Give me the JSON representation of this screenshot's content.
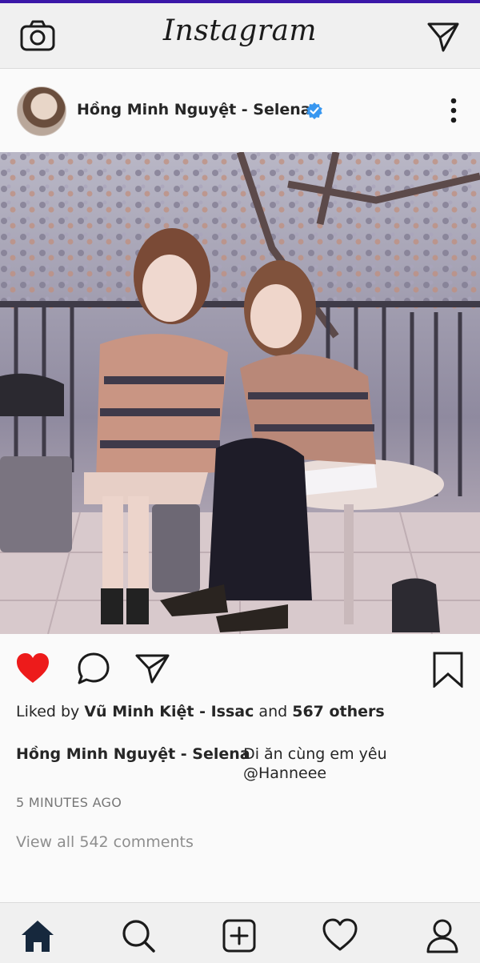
{
  "app": {
    "title": "Instagram"
  },
  "header": {
    "camera_icon": "camera-icon",
    "direct_icon": "paper-plane-icon"
  },
  "post": {
    "username": "Hồng Minh Nguyệt - Selena",
    "verified": true,
    "photo_alt": "two-friends-photo",
    "liked_by_prefix": "Liked by",
    "liked_by_user": "Vũ Minh Kiệt - Issac",
    "liked_by_and": " and",
    "liked_by_others": "567 others",
    "caption_user": "Hồng Minh Nguyệt - Selena",
    "caption_text": "Đi ăn cùng em yêu @Hanneee",
    "timestamp": "5 MINUTES AGO",
    "view_comments": "View all 542 comments",
    "liked": true
  },
  "colors": {
    "like_red": "#ed1b1b",
    "verified_blue": "#3897f0",
    "accent_purple": "#3b17a8"
  }
}
